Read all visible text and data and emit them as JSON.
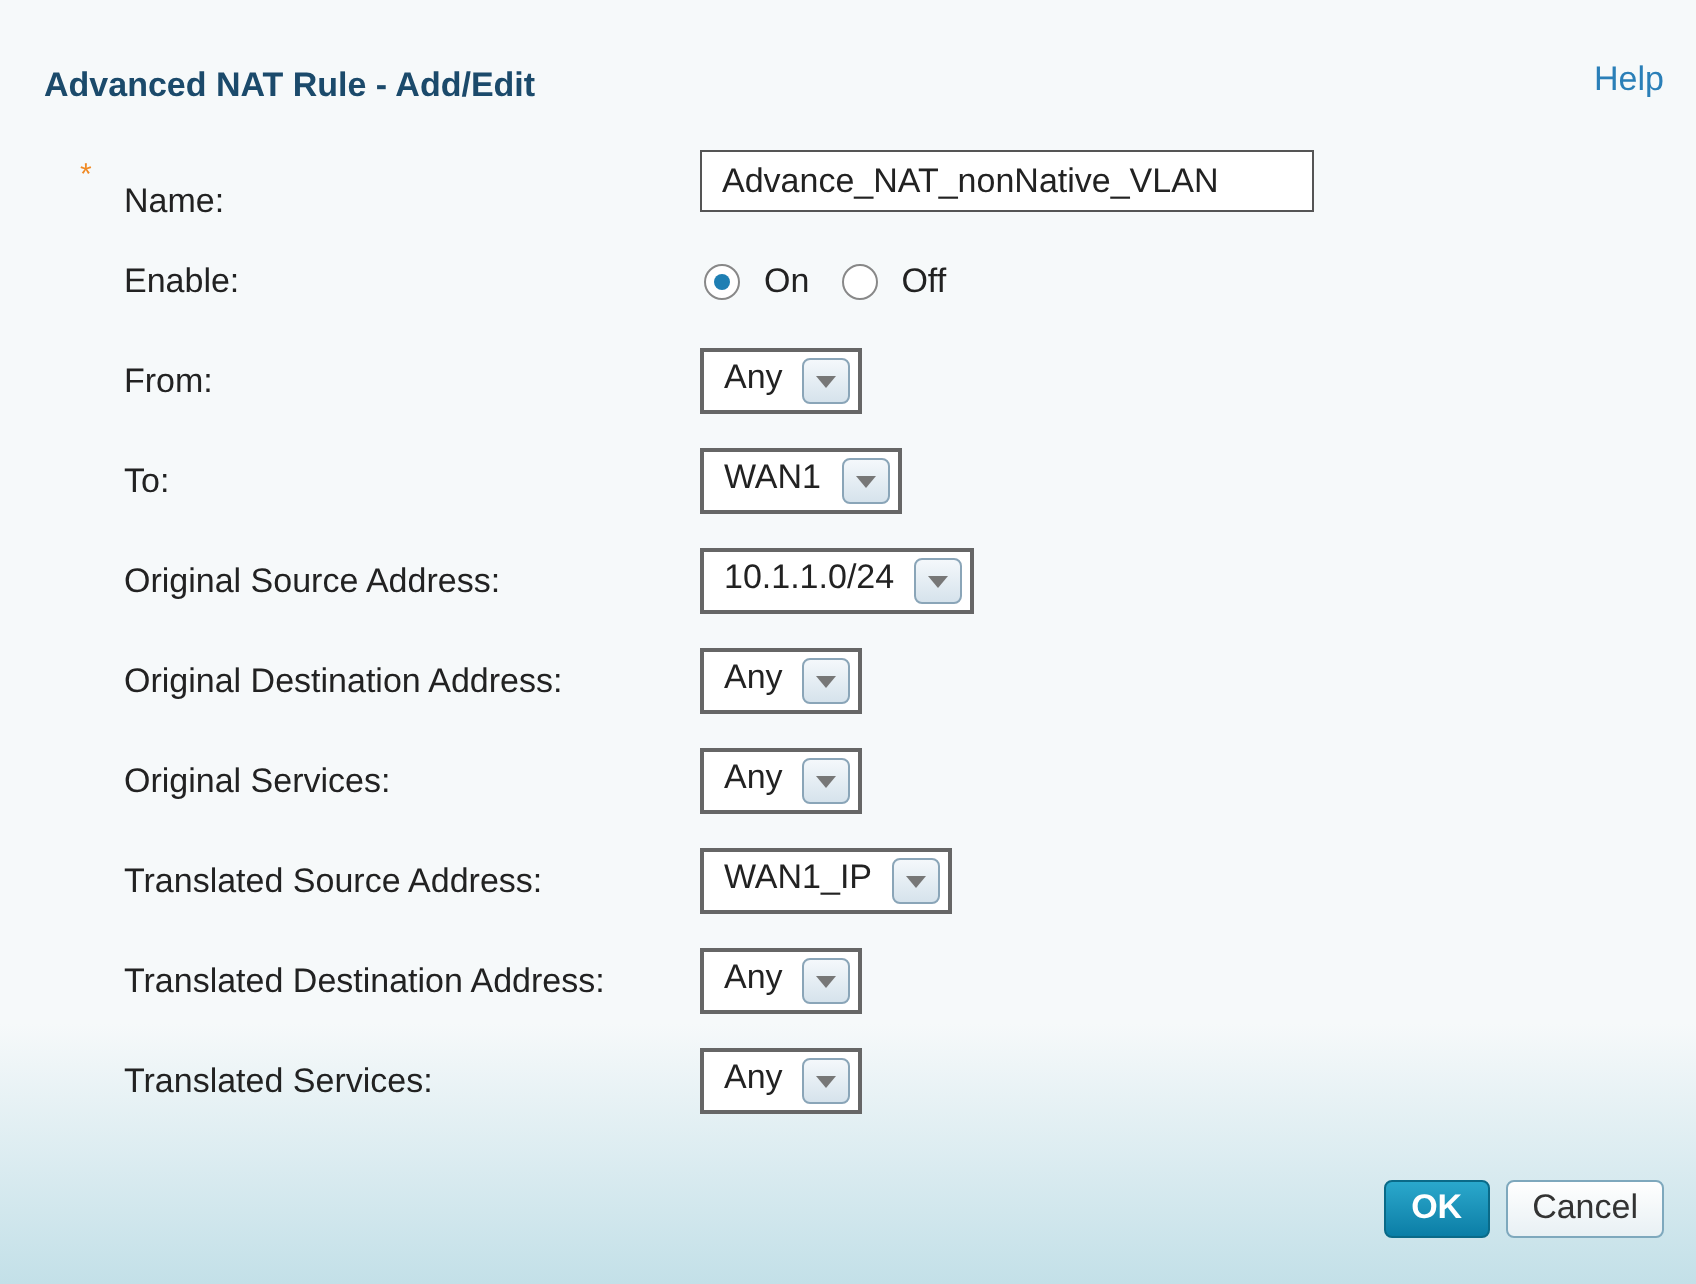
{
  "dialog": {
    "title": "Advanced NAT Rule - Add/Edit",
    "help_link": "Help"
  },
  "fields": [
    {
      "kind": "text",
      "label": "Name:",
      "marker": "*",
      "value": "Advance_NAT_nonNative_VLAN"
    },
    {
      "kind": "radio",
      "label": "Enable:",
      "options": [
        {
          "label": "On",
          "selected": true
        },
        {
          "label": "Off",
          "selected": false
        }
      ]
    },
    {
      "kind": "select",
      "label": "From:",
      "value": "Any"
    },
    {
      "kind": "select",
      "label": "To:",
      "value": "WAN1"
    },
    {
      "kind": "select",
      "label": "Original Source Address:",
      "value": "10.1.1.0/24"
    },
    {
      "kind": "select",
      "label": "Original Destination Address:",
      "value": "Any"
    },
    {
      "kind": "select",
      "label": "Original Services:",
      "value": "Any"
    },
    {
      "kind": "select",
      "label": "Translated Source Address:",
      "value": "WAN1_IP"
    },
    {
      "kind": "select",
      "label": "Translated Destination Address:",
      "value": "Any"
    },
    {
      "kind": "select",
      "label": "Translated Services:",
      "value": "Any"
    }
  ],
  "buttons": [
    {
      "label": "OK",
      "kind": "primary"
    },
    {
      "label": "Cancel",
      "kind": "secondary"
    }
  ]
}
